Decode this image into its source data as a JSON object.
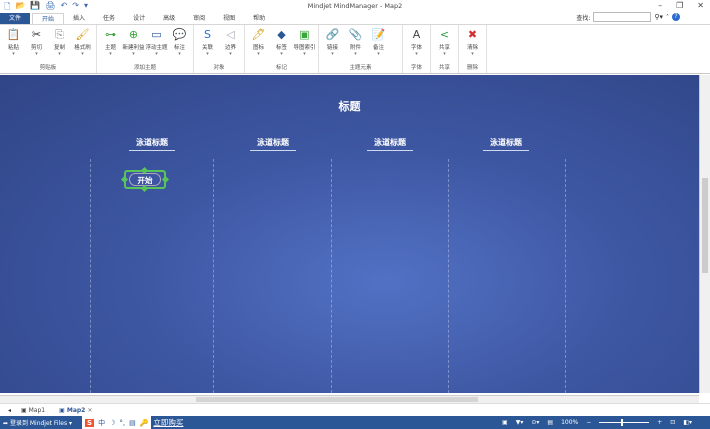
{
  "window": {
    "title": "Mindjet MindManager - Map2",
    "controls": [
      "–",
      "❐",
      "✕"
    ]
  },
  "qat": [
    "🗋",
    "📂",
    "💾",
    "🖨",
    "↶",
    "↷",
    "▾"
  ],
  "tabs": [
    "文件",
    "开始",
    "插入",
    "任务",
    "设计",
    "高级",
    "审阅",
    "视图",
    "帮助"
  ],
  "search": {
    "label": "查找:",
    "value": ""
  },
  "ribbon": [
    {
      "label": "剪贴板",
      "buttons": [
        {
          "label": "粘贴",
          "icon": "📋",
          "color": "#c9a13b"
        },
        {
          "label": "剪切",
          "icon": "✂",
          "color": "#333"
        },
        {
          "label": "复制",
          "icon": "⎘",
          "color": "#888"
        },
        {
          "label": "格式刷",
          "icon": "🖌",
          "color": "#d4a017"
        }
      ]
    },
    {
      "label": "添加主题",
      "buttons": [
        {
          "label": "主题",
          "icon": "⊶",
          "color": "#3aa53a"
        },
        {
          "label": "新建利益",
          "icon": "⊕",
          "color": "#3aa53a"
        },
        {
          "label": "浮动主题",
          "icon": "▭",
          "color": "#2b5797"
        },
        {
          "label": "标注",
          "icon": "💬",
          "color": "#d4a017"
        }
      ]
    },
    {
      "label": "对象",
      "buttons": [
        {
          "label": "关联",
          "icon": "S",
          "color": "#2b6bd1"
        },
        {
          "label": "边界",
          "icon": "◁",
          "color": "#aab"
        }
      ]
    },
    {
      "label": "标记",
      "buttons": [
        {
          "label": "图标",
          "icon": "🖊",
          "color": "#d4a017"
        },
        {
          "label": "标签",
          "icon": "◆",
          "color": "#2b5797"
        },
        {
          "label": "导图索引",
          "icon": "▣",
          "color": "#3aa53a"
        }
      ]
    },
    {
      "label": "主题元素",
      "buttons": [
        {
          "label": "链接",
          "icon": "🔗",
          "color": "#3a8ad1"
        },
        {
          "label": "附件",
          "icon": "📎",
          "color": "#555"
        },
        {
          "label": "备注",
          "icon": "📝",
          "color": "#d4a017"
        }
      ]
    },
    {
      "label": "字体",
      "buttons": [
        {
          "label": "字体",
          "icon": "A",
          "color": "#444"
        }
      ]
    },
    {
      "label": "共享",
      "buttons": [
        {
          "label": "共享",
          "icon": "<",
          "color": "#2e9e3e"
        }
      ]
    },
    {
      "label": "删除",
      "buttons": [
        {
          "label": "清除",
          "icon": "✖",
          "color": "#d32f2f"
        }
      ]
    }
  ],
  "map": {
    "title": "标题",
    "lanes": [
      "泳道标题",
      "泳道标题",
      "泳道标题",
      "泳道标题"
    ],
    "start_node": "开始"
  },
  "doc_tabs": [
    "Map1",
    "Map2"
  ],
  "status": {
    "login": "登录到 Mindjet Files",
    "ime": [
      "S",
      "中",
      "☽",
      "°,",
      "▤",
      "🔑"
    ],
    "buy": "立即购买",
    "zoom": "100%"
  }
}
